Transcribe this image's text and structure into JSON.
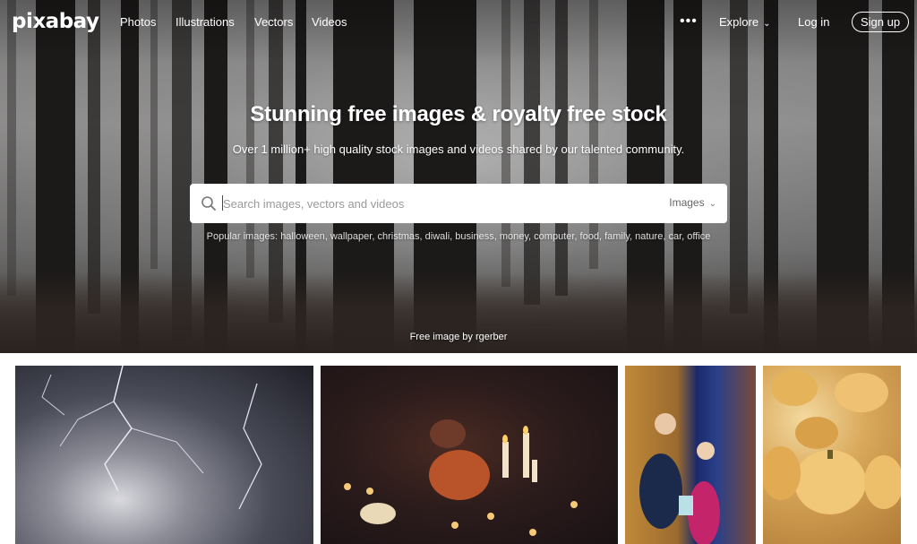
{
  "nav": {
    "logo": "pixabay",
    "links": [
      "Photos",
      "Illustrations",
      "Vectors",
      "Videos"
    ],
    "more": "•••",
    "explore": "Explore",
    "login": "Log in",
    "signup": "Sign up"
  },
  "hero": {
    "headline": "Stunning free images & royalty free stock",
    "subhead": "Over 1 million+ high quality stock images and videos shared by our talented community.",
    "search": {
      "placeholder": "Search images, vectors and videos",
      "type": "Images"
    },
    "popular_label": "Popular images:",
    "popular_tags": [
      "halloween",
      "wallpaper",
      "christmas",
      "diwali",
      "business",
      "money",
      "computer",
      "food",
      "family",
      "nature",
      "car",
      "office"
    ],
    "credit": "Free image by rgerber"
  },
  "icons": {
    "search": "search-icon",
    "chevron": "chevron-down-icon",
    "more": "more-dots-icon"
  },
  "colors": {
    "text_on_hero": "#ffffff",
    "search_bg": "#ffffff",
    "placeholder": "#9a9a9a"
  }
}
